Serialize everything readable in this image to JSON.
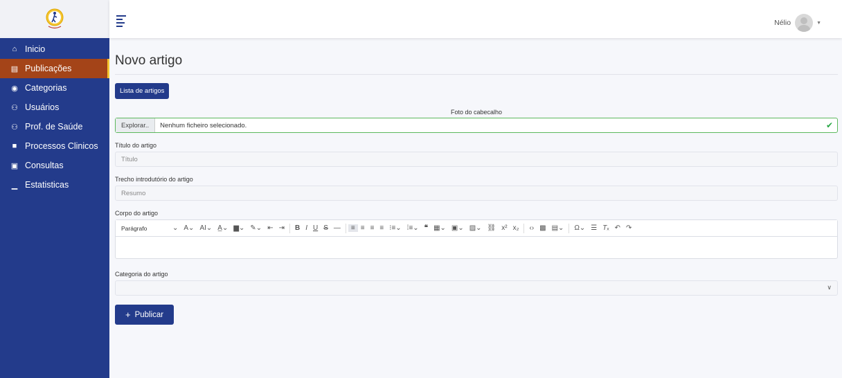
{
  "logo": {
    "name": "app-logo"
  },
  "sidebar": {
    "items": [
      {
        "label": "Inicio",
        "icon": "home-icon",
        "glyph": "⌂",
        "active": false
      },
      {
        "label": "Publicações",
        "icon": "newspaper-icon",
        "glyph": "▤",
        "active": true
      },
      {
        "label": "Categorias",
        "icon": "tags-icon",
        "glyph": "◉",
        "active": false
      },
      {
        "label": "Usuários",
        "icon": "users-icon",
        "glyph": "⚇",
        "active": false
      },
      {
        "label": "Prof. de Saúde",
        "icon": "users-icon",
        "glyph": "⚇",
        "active": false
      },
      {
        "label": "Processos Clinicos",
        "icon": "archive-icon",
        "glyph": "■",
        "active": false
      },
      {
        "label": "Consultas",
        "icon": "calendar-check-icon",
        "glyph": "▣",
        "active": false
      },
      {
        "label": "Estatisticas",
        "icon": "chart-bar-icon",
        "glyph": "▁",
        "active": false
      }
    ]
  },
  "topbar": {
    "user_name": "Nélio",
    "caret": "▼"
  },
  "main": {
    "title": "Novo artigo",
    "list_button": "Lista de artigos",
    "foto_label": "Foto do cabecalho",
    "file_browse": "Explorar..",
    "file_text": "Nenhum ficheiro selecionado.",
    "check": "✔",
    "title_label": "Título do artigo",
    "title_placeholder": "Título",
    "excerpt_label": "Trecho introdutório do artigo",
    "excerpt_placeholder": "Resumo",
    "body_label": "Corpo do artigo",
    "paragraph": "Parágrafo",
    "category_label": "Categoria do artigo",
    "chevron": "∨",
    "publish_plus": "+",
    "publish_label": "Publicar"
  },
  "colors": {
    "sidebar": "#233b8b",
    "active": "#a44418",
    "accent": "#f4c531",
    "success": "#28a745"
  }
}
